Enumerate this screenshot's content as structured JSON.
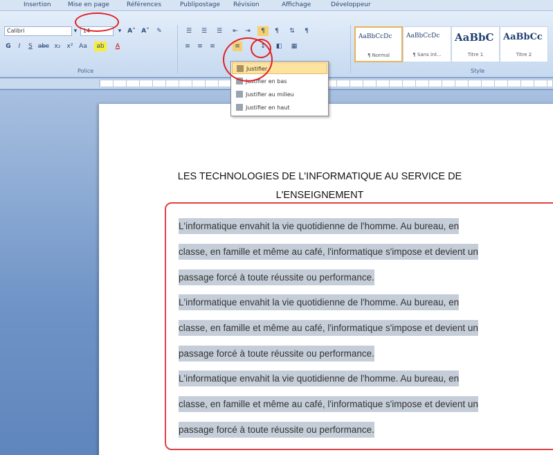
{
  "ribbon": {
    "tabs": [
      "Insertion",
      "Mise en page",
      "Références",
      "Publipostage",
      "Révision",
      "Affichage",
      "Développeur"
    ],
    "font": {
      "name": "Calibri",
      "size": "14"
    },
    "groups": {
      "police": "Police",
      "style": "Style"
    },
    "styles": [
      {
        "sample": "AaBbCcDc",
        "name": "¶ Normal"
      },
      {
        "sample": "AaBbCcDc",
        "name": "¶ Sans int..."
      },
      {
        "sample": "AaBbC",
        "name": "Titre 1"
      },
      {
        "sample": "AaBbCc",
        "name": "Titre 2"
      }
    ]
  },
  "alignment_menu": {
    "items": [
      "Justifier",
      "Justifier en bas",
      "Justifier au milieu",
      "Justifier en haut"
    ],
    "selected_index": 0
  },
  "document": {
    "title_line1": "LES TECHNOLOGIES  DE L'INFORMATIQUE AU SERVICE DE",
    "title_line2": "L'ENSEIGNEMENT",
    "paragraphs": [
      [
        "L'informatique envahit la vie quotidienne de l'homme. Au bureau, en",
        "classe, en famille et même au café, l'informatique s'impose et devient un",
        "passage forcé à toute réussite ou performance."
      ],
      [
        "L'informatique envahit la vie quotidienne de l'homme. Au bureau, en",
        "classe, en famille et même au café, l'informatique s'impose et devient un",
        "passage forcé à toute réussite ou performance."
      ],
      [
        "L'informatique envahit la vie quotidienne de l'homme. Au bureau, en",
        "classe, en famille et même au café, l'informatique s'impose et devient un",
        "passage forcé à toute réussite ou performance."
      ]
    ]
  },
  "colors": {
    "highlight": "#c5ced8",
    "annotation_red": "#e02020",
    "menu_active": "#fde3a0"
  }
}
